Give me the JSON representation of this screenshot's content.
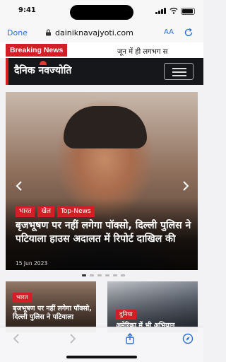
{
  "status_bar": {
    "time": "9:41"
  },
  "browser": {
    "done_label": "Done",
    "url": "dainiknavajyoti.com",
    "text_size_label": "AA",
    "accent_color": "#2a6fd6"
  },
  "breaking": {
    "label": "Breaking News",
    "ticker_text": "जून में ही लगभग स",
    "label_color": "#d31e26"
  },
  "site": {
    "logo_text": "दैनिक नवज्योति",
    "header_bg": "#16171b",
    "menu_icon": "hamburger-icon"
  },
  "hero": {
    "tags": [
      "भारत",
      "खेल",
      "Top-News"
    ],
    "title": "बृजभूषण पर नहीं लगेगा पॉक्सो, दिल्ली पुलिस ने पटियाला हाउस अदालत में रिपोर्ट दाखिल की",
    "date": "15 Jun 2023",
    "slide_count": 6,
    "active_slide": 1
  },
  "cards": [
    {
      "tag": "भारत",
      "title": "बृजभूषण पर नहीं लगेगा पॉक्सो, दिल्ली पुलिस ने पटियाला"
    },
    {
      "tag": "दुनिया",
      "title": "अमेरिका में भी अभियान"
    }
  ],
  "toolbar": {
    "icons": [
      "back-icon",
      "forward-icon",
      "share-icon",
      "compass-icon"
    ]
  }
}
